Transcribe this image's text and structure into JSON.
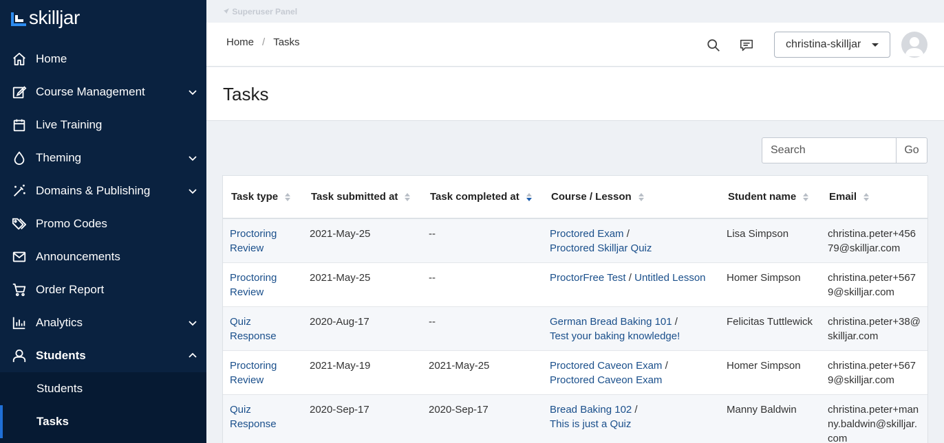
{
  "app": {
    "logo_text": "skilljar",
    "brand_color": "#0a2240",
    "accent_color": "#2d8cf0"
  },
  "sidebar": {
    "items": [
      {
        "label": "Home",
        "icon": "home-icon",
        "expandable": false
      },
      {
        "label": "Course Management",
        "icon": "edit-icon",
        "expandable": true
      },
      {
        "label": "Live Training",
        "icon": "calendar-icon",
        "expandable": false
      },
      {
        "label": "Theming",
        "icon": "drop-icon",
        "expandable": true
      },
      {
        "label": "Domains & Publishing",
        "icon": "magic-wand-icon",
        "expandable": true
      },
      {
        "label": "Promo Codes",
        "icon": "tags-icon",
        "expandable": false
      },
      {
        "label": "Announcements",
        "icon": "mail-icon",
        "expandable": false
      },
      {
        "label": "Order Report",
        "icon": "cart-icon",
        "expandable": false
      },
      {
        "label": "Analytics",
        "icon": "bar-chart-icon",
        "expandable": true
      },
      {
        "label": "Students",
        "icon": "user-icon",
        "expandable": true,
        "expanded": true
      }
    ],
    "subitems": [
      {
        "label": "Students"
      },
      {
        "label": "Tasks",
        "current": true
      }
    ]
  },
  "superbar": {
    "label": "Superuser Panel"
  },
  "topbar": {
    "breadcrumb": [
      "Home",
      "Tasks"
    ],
    "account_label": "christina-skilljar"
  },
  "page": {
    "title": "Tasks"
  },
  "search": {
    "placeholder": "Search",
    "button_label": "Go"
  },
  "table": {
    "columns": [
      "Task type",
      "Task submitted at",
      "Task completed at",
      "Course / Lesson",
      "Student name",
      "Email"
    ],
    "sorted_column": "Task completed at",
    "rows": [
      {
        "type": "Proctoring Review",
        "submitted": "2021-May-25",
        "completed": "--",
        "course": "Proctored Exam",
        "lesson": "Proctored Skilljar Quiz",
        "student": "Lisa Simpson",
        "email": "christina.peter+45679@skilljar.com"
      },
      {
        "type": "Proctoring Review",
        "submitted": "2021-May-25",
        "completed": "--",
        "course": "ProctorFree Test",
        "lesson": "Untitled Lesson",
        "student": "Homer Simpson",
        "email": "christina.peter+5679@skilljar.com"
      },
      {
        "type": "Quiz Response",
        "submitted": "2020-Aug-17",
        "completed": "--",
        "course": "German Bread Baking 101",
        "lesson": "Test your baking knowledge!",
        "student": "Felicitas Tuttlewick",
        "email": "christina.peter+38@skilljar.com"
      },
      {
        "type": "Proctoring Review",
        "submitted": "2021-May-19",
        "completed": "2021-May-25",
        "course": "Proctored Caveon Exam",
        "lesson": "Proctored Caveon Exam",
        "student": "Homer Simpson",
        "email": "christina.peter+5679@skilljar.com"
      },
      {
        "type": "Quiz Response",
        "submitted": "2020-Sep-17",
        "completed": "2020-Sep-17",
        "course": "Bread Baking 102",
        "lesson": "This is just a Quiz",
        "student": "Manny Baldwin",
        "email": "christina.peter+manny.baldwin@skilljar.com"
      }
    ]
  }
}
